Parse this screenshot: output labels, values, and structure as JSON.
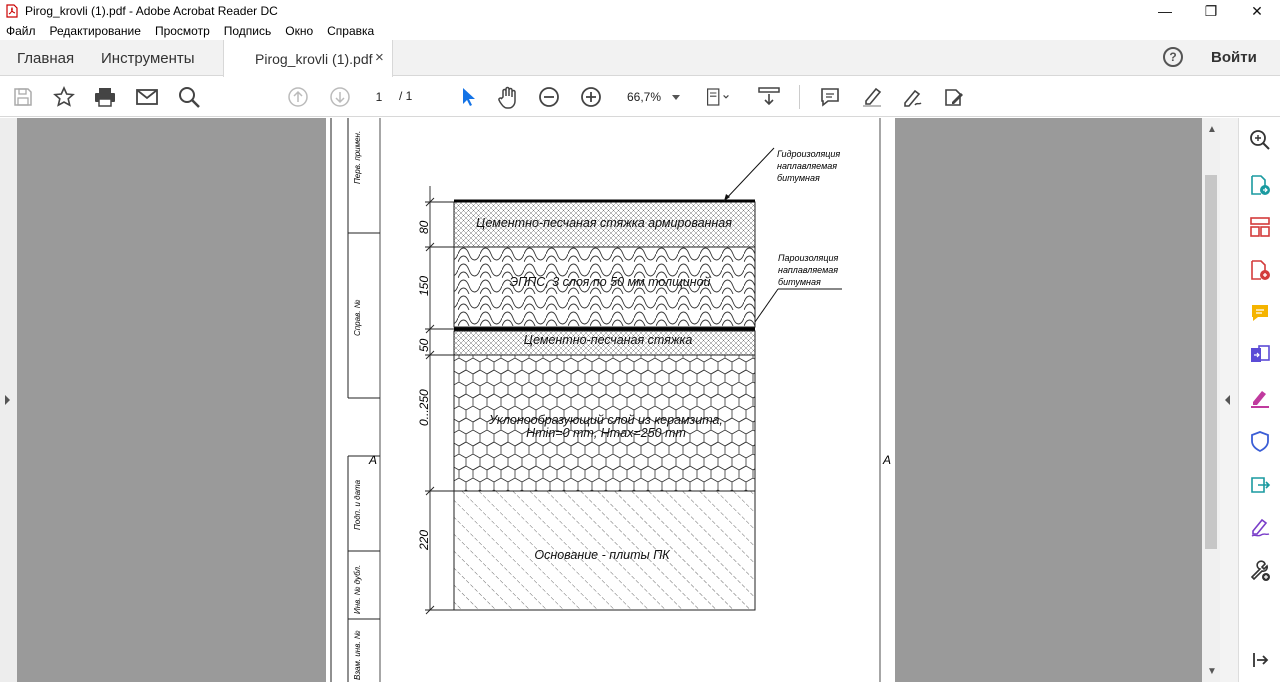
{
  "window": {
    "title": "Pirog_krovli (1).pdf - Adobe Acrobat Reader DC",
    "controls": [
      "—",
      "❐",
      "✕"
    ]
  },
  "menu": {
    "file": "Файл",
    "edit": "Редактирование",
    "view": "Просмотр",
    "sign": "Подпись",
    "window": "Окно",
    "help": "Справка"
  },
  "tabs": {
    "home": "Главная",
    "tools": "Инструменты",
    "document": "Pirog_krovli (1).pdf",
    "close": "×",
    "help_icon": "?",
    "signin": "Войти"
  },
  "toolbar": {
    "page_current": "1",
    "page_total": "/ 1",
    "zoom": "66,7%",
    "icons": [
      "save-icon",
      "star-icon",
      "print-icon",
      "mail-icon",
      "search-icon",
      "page-up-icon",
      "page-down-icon",
      "select-cursor-icon",
      "hand-icon",
      "zoom-out-icon",
      "zoom-in-icon",
      "page-fit-icon",
      "scroll-mode-icon",
      "comment-icon",
      "highlight-icon",
      "fill-sign-icon",
      "more-tools-icon"
    ]
  },
  "drawing": {
    "layers": [
      "Цементно-песчаная стяжка армированная",
      "ЭППС, 3 слоя по 50 мм толщиной",
      "Цементно-песчаная стяжка",
      "Уклонообразующий слой из керамзита,",
      "Hmin=0 mm, Hmax=250 mm",
      "Основание - плиты ПК"
    ],
    "dimensions": [
      "80",
      "150",
      "50",
      "0...250",
      "220"
    ],
    "callout_top": [
      "Гидроизоляция",
      "наплавляемая",
      "битумная"
    ],
    "callout_mid": [
      "Пароизоляция",
      "наплавляемая",
      "битумная"
    ],
    "section_mark": "А",
    "stamp": [
      "Перв. примен.",
      "Справ. №",
      "Подп. и дата",
      "Инв. № дубл.",
      "Взам. инв. №"
    ]
  },
  "right_panel": {
    "icons": [
      "zoom-panel-icon",
      "export-pdf-icon",
      "organize-pages-icon",
      "create-pdf-icon",
      "comment-panel-icon",
      "combine-icon",
      "fill-sign-panel-icon",
      "protect-icon",
      "send-icon",
      "signature-icon",
      "more-tools-panel-icon",
      "collapse-panel-icon"
    ]
  }
}
